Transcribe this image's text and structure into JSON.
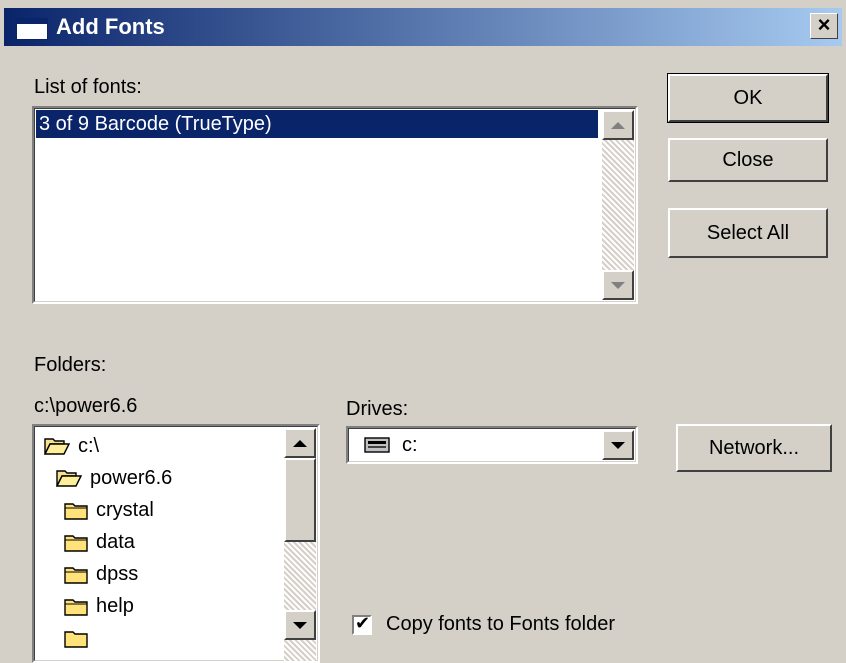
{
  "window": {
    "title": "Add Fonts",
    "close_glyph": "×"
  },
  "fonts": {
    "label": "List of fonts:",
    "items": [
      "3 of 9 Barcode (TrueType)"
    ],
    "selected": 0
  },
  "buttons": {
    "ok": "OK",
    "close": "Close",
    "select_all": "Select All",
    "network": "Network..."
  },
  "folders": {
    "label": "Folders:",
    "current_path": "c:\\power6.6",
    "items": [
      {
        "name": "c:\\",
        "icon": "open-folder-icon"
      },
      {
        "name": "power6.6",
        "icon": "open-folder-icon"
      },
      {
        "name": "crystal",
        "icon": "folder-icon"
      },
      {
        "name": "data",
        "icon": "folder-icon"
      },
      {
        "name": "dpss",
        "icon": "folder-icon"
      },
      {
        "name": "help",
        "icon": "folder-icon"
      }
    ]
  },
  "drives": {
    "label": "Drives:",
    "selected": "c:",
    "icon": "drive-icon"
  },
  "copy_fonts": {
    "label": "Copy fonts to Fonts folder",
    "checked": true
  },
  "colors": {
    "selection": "#0a246a",
    "face": "#d4d0c8",
    "window": "#ffffff"
  }
}
